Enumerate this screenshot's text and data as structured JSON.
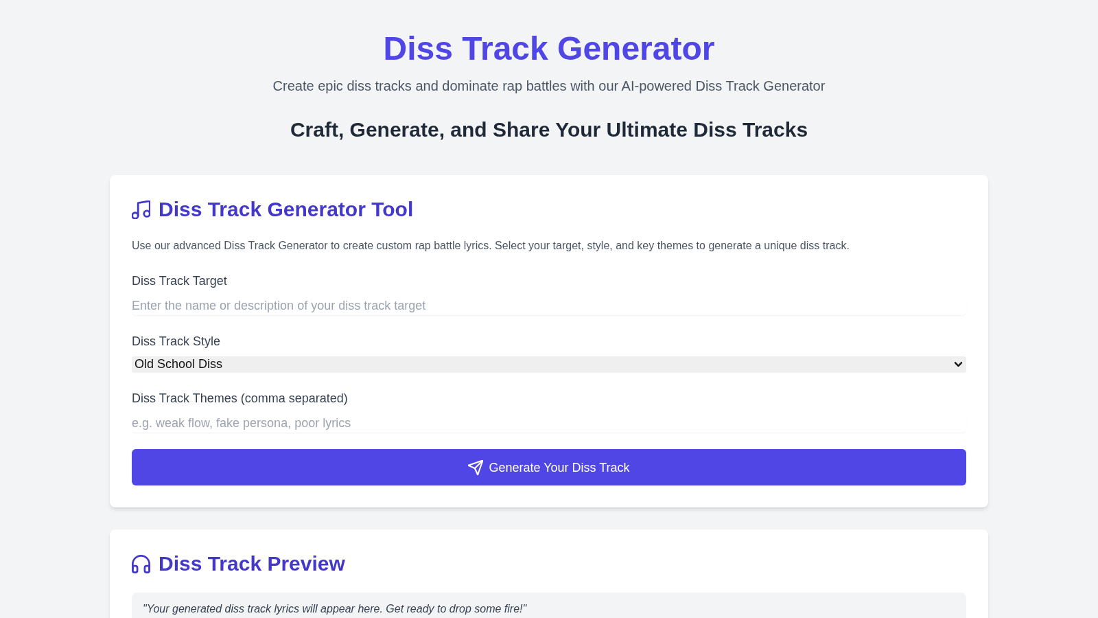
{
  "header": {
    "title": "Diss Track Generator",
    "subtitle": "Create epic diss tracks and dominate rap battles with our AI-powered Diss Track Generator",
    "tagline": "Craft, Generate, and Share Your Ultimate Diss Tracks"
  },
  "generator_card": {
    "title": "Diss Track Generator Tool",
    "description": "Use our advanced Diss Track Generator to create custom rap battle lyrics. Select your target, style, and key themes to generate a unique diss track.",
    "fields": [
      {
        "kind": "text",
        "label": "Diss Track Target",
        "placeholder": "Enter the name or description of your diss track target"
      },
      {
        "kind": "select",
        "label": "Diss Track Style",
        "value": "Old School Diss"
      },
      {
        "kind": "text",
        "label": "Diss Track Themes (comma separated)",
        "placeholder": "e.g. weak flow, fake persona, poor lyrics"
      }
    ],
    "button": {
      "label": "Generate Your Diss Track"
    }
  },
  "preview_card": {
    "title": "Diss Track Preview",
    "text": "\"Your generated diss track lyrics will appear here. Get ready to drop some fire!\""
  }
}
